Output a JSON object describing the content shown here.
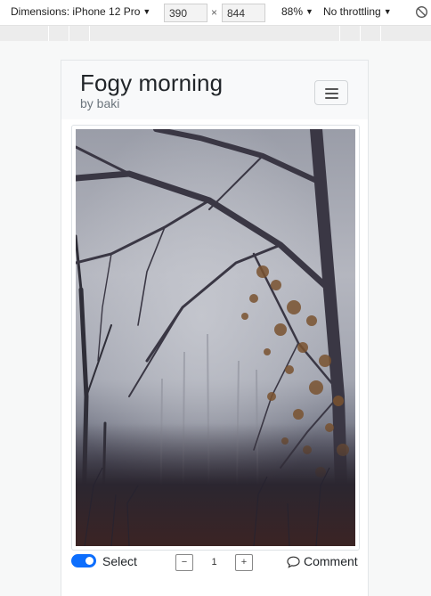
{
  "devtools": {
    "dimensions_label": "Dimensions: iPhone 12 Pro",
    "width_value": "390",
    "times": "×",
    "height_value": "844",
    "zoom": "88%",
    "throttling": "No throttling"
  },
  "post": {
    "title": "Fogy morning",
    "byline": "by baki"
  },
  "actions": {
    "select_label": "Select",
    "select_on": true,
    "stepper_minus": "−",
    "stepper_value": "1",
    "stepper_plus": "+",
    "comment_label": "Comment"
  },
  "colors": {
    "accent": "#0d6efd"
  }
}
